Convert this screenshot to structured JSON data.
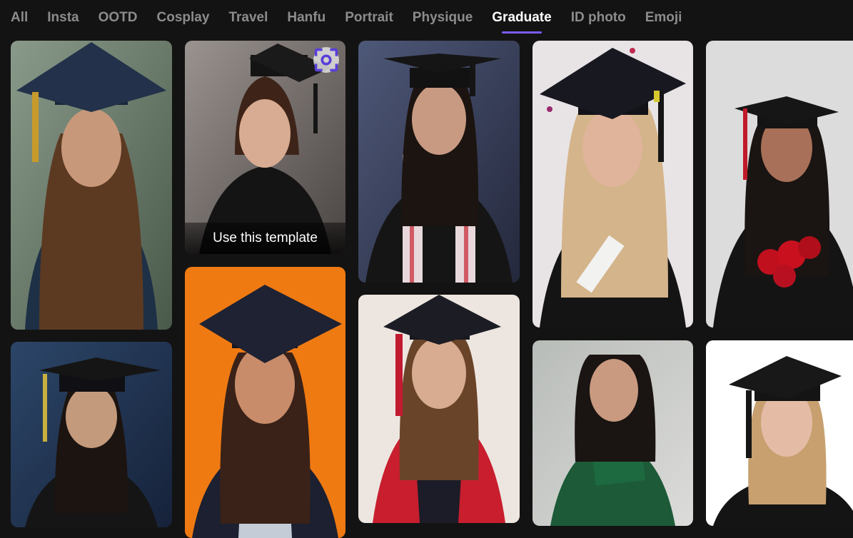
{
  "tabs": [
    {
      "label": "All"
    },
    {
      "label": "Insta"
    },
    {
      "label": "OOTD"
    },
    {
      "label": "Cosplay"
    },
    {
      "label": "Travel"
    },
    {
      "label": "Hanfu"
    },
    {
      "label": "Portrait"
    },
    {
      "label": "Physique"
    },
    {
      "label": "Graduate"
    },
    {
      "label": "ID photo"
    },
    {
      "label": "Emoji"
    }
  ],
  "active_tab": "Graduate",
  "hover_card": {
    "use_template_label": "Use this template",
    "icon": "scan-icon"
  },
  "colors": {
    "accent": "#7a5cff",
    "background": "#131313",
    "tab_inactive": "#8c8c8c",
    "tab_active": "#ffffff"
  }
}
